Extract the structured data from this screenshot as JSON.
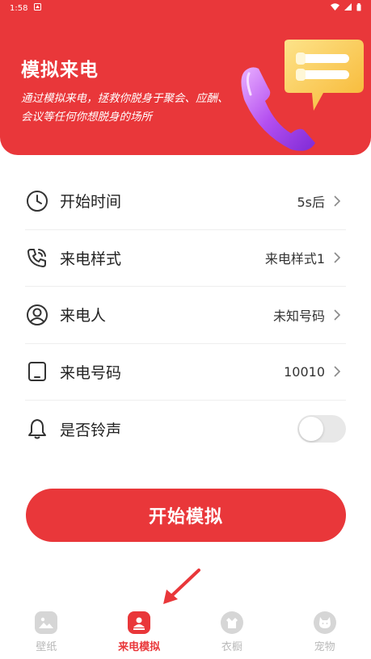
{
  "status_bar": {
    "time": "1:58"
  },
  "header": {
    "title": "模拟来电",
    "description": "通过模拟来电，拯救你脱身于聚会、应酬、会议等任何你想脱身的场所"
  },
  "settings": {
    "start_time": {
      "label": "开始时间",
      "value": "5s后",
      "icon": "clock-icon"
    },
    "call_style": {
      "label": "来电样式",
      "value": "来电样式1",
      "icon": "phone-call-icon"
    },
    "caller": {
      "label": "来电人",
      "value": "未知号码",
      "icon": "user-circle-icon"
    },
    "caller_number": {
      "label": "来电号码",
      "value": "10010",
      "icon": "tablet-icon"
    },
    "ringtone": {
      "label": "是否铃声",
      "enabled": false,
      "icon": "bell-icon"
    }
  },
  "start_button": {
    "label": "开始模拟"
  },
  "tabs": [
    {
      "label": "壁纸",
      "icon": "image-icon",
      "active": false
    },
    {
      "label": "来电模拟",
      "icon": "contact-icon",
      "active": true
    },
    {
      "label": "衣橱",
      "icon": "closet-icon",
      "active": false
    },
    {
      "label": "宠物",
      "icon": "pet-icon",
      "active": false
    }
  ],
  "colors": {
    "accent": "#e9373a",
    "inactive": "#b9b9b9",
    "toggle_off": "#e8e8e8"
  }
}
